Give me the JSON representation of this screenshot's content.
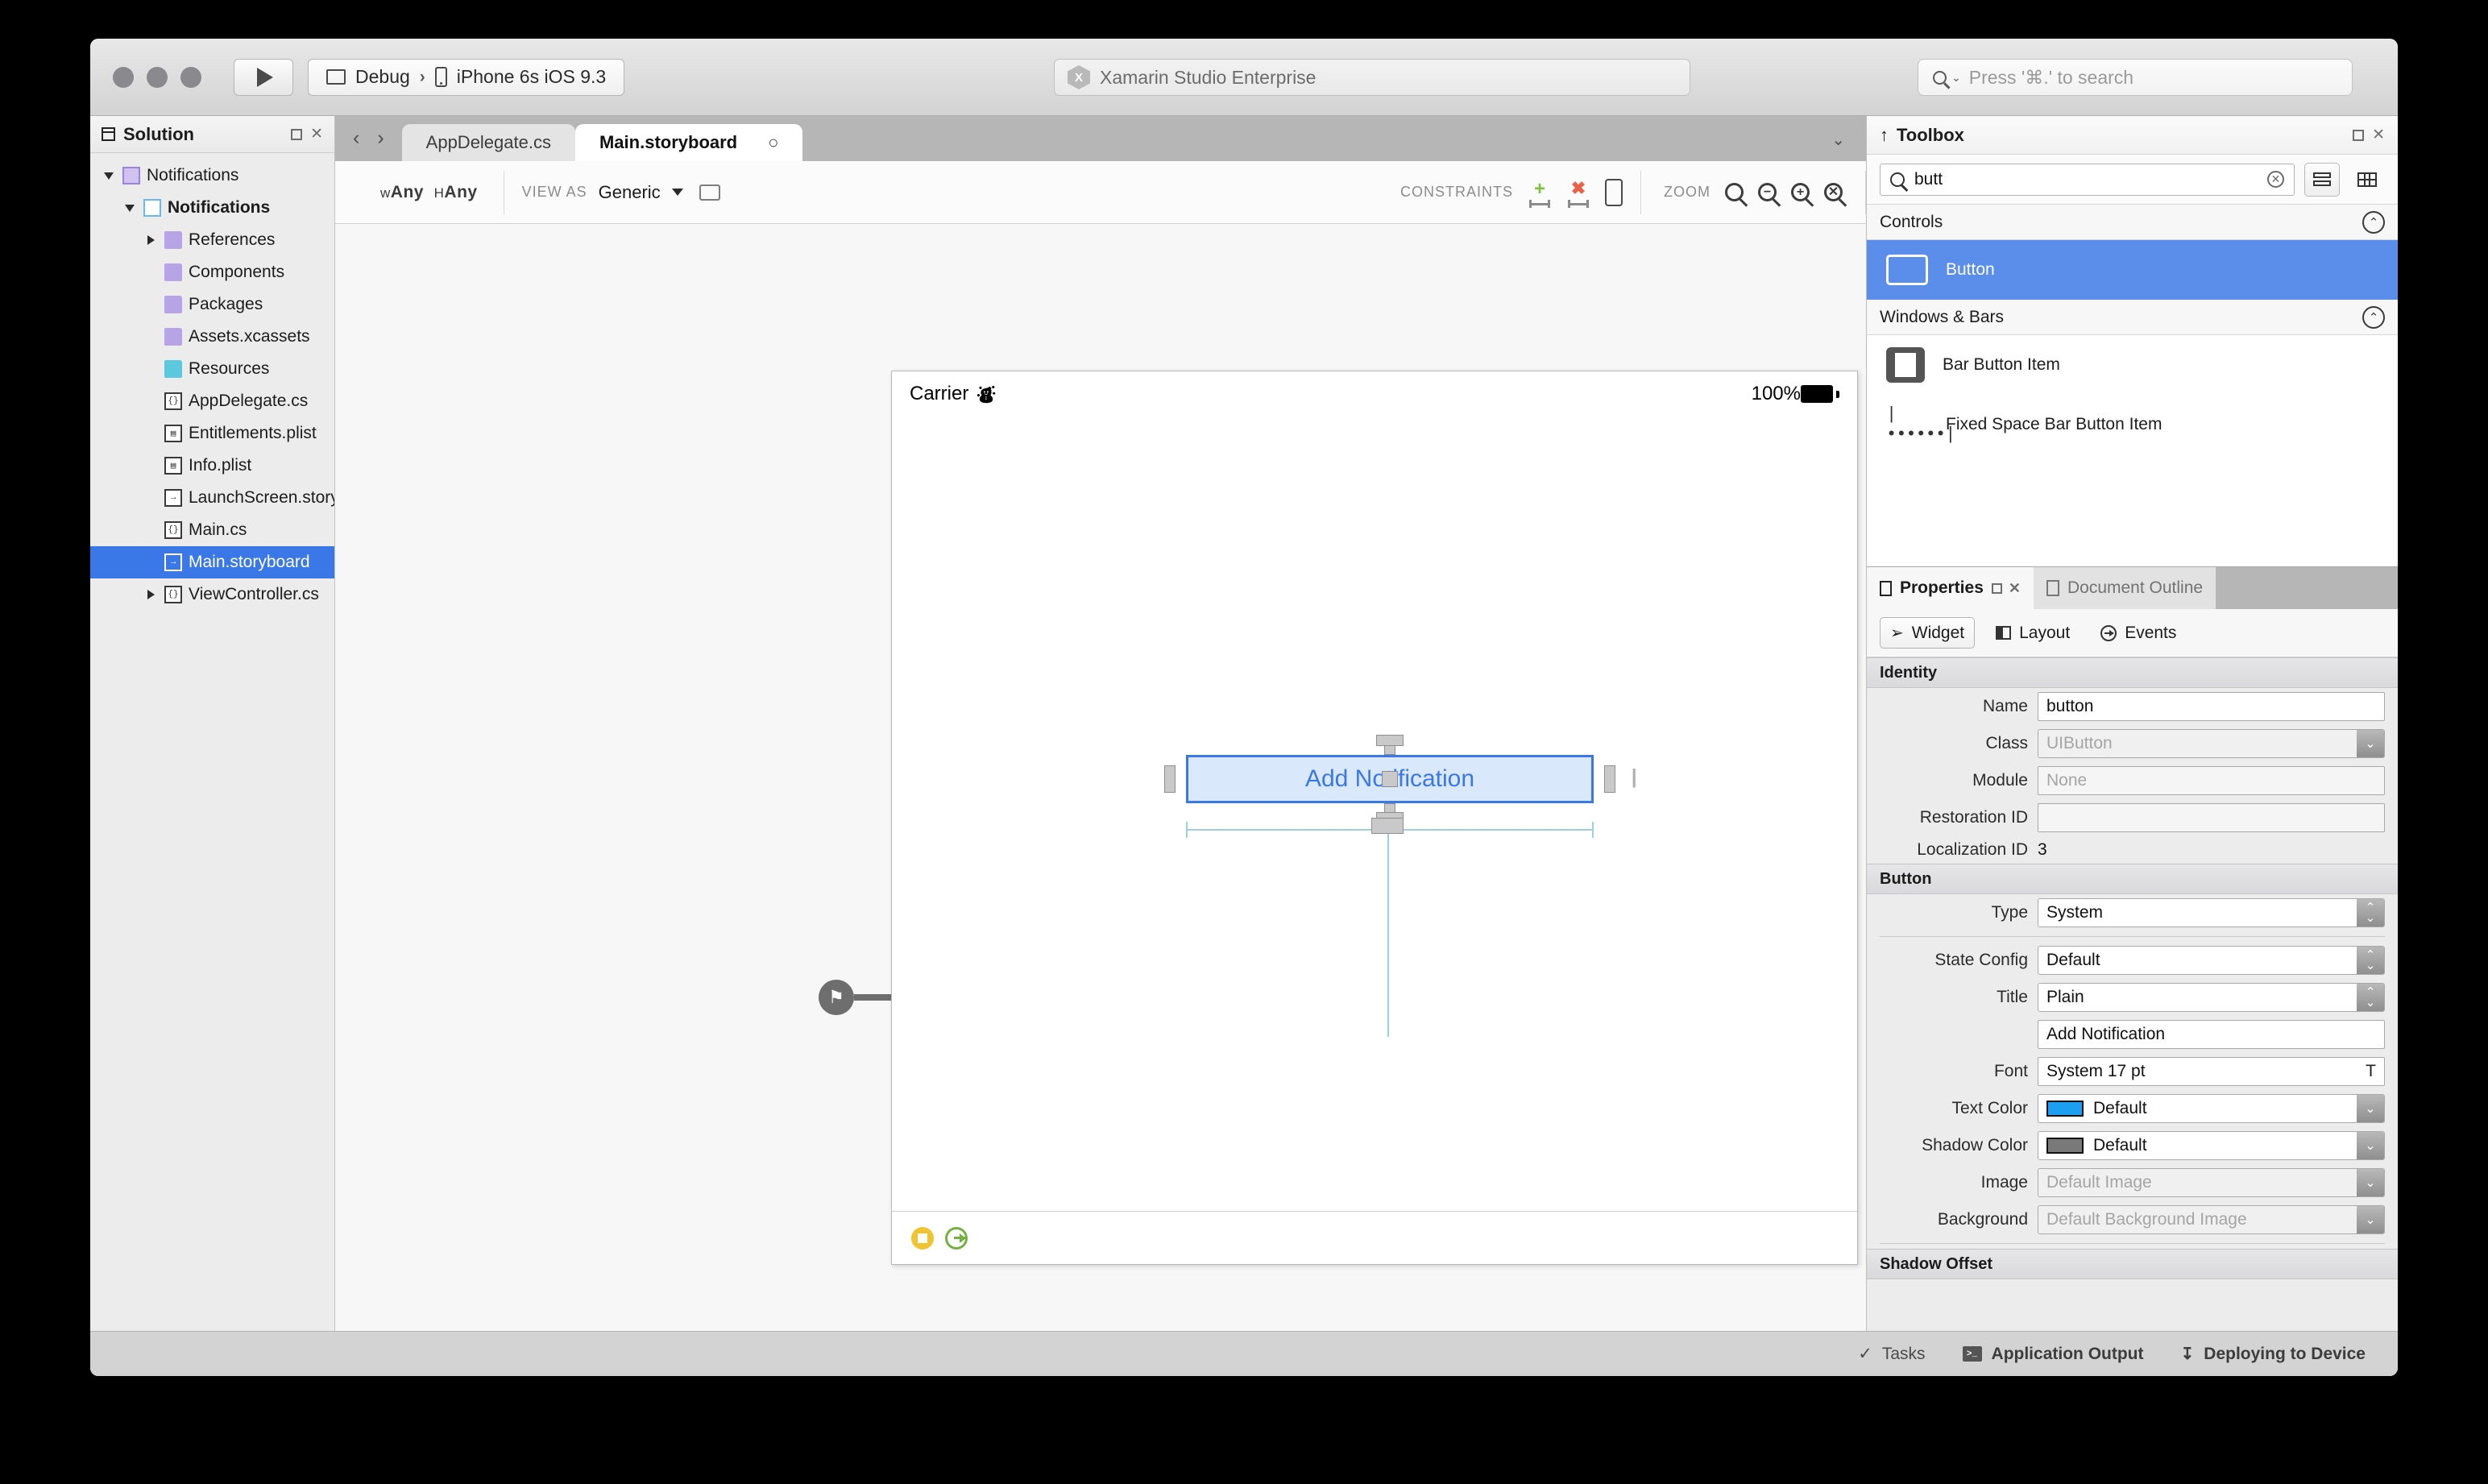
{
  "titlebar": {
    "run_label": "run-button",
    "configuration": "Debug",
    "device": "iPhone 6s iOS 9.3",
    "separator": "›",
    "status_badge": "X",
    "status_text": "Xamarin Studio Enterprise",
    "search_placeholder": "Press '⌘.' to search"
  },
  "solution": {
    "title": "Solution",
    "tree": [
      {
        "label": "Notifications",
        "icon": "solution-icon",
        "indent": 0,
        "twisty": "down",
        "selected": false,
        "bold": false
      },
      {
        "label": "Notifications",
        "icon": "project-icon",
        "indent": 1,
        "twisty": "down",
        "selected": false,
        "bold": true
      },
      {
        "label": "References",
        "icon": "folder-purple-icon",
        "indent": 2,
        "twisty": "right",
        "selected": false,
        "bold": false
      },
      {
        "label": "Components",
        "icon": "folder-purple-icon",
        "indent": 2,
        "twisty": "none",
        "selected": false,
        "bold": false
      },
      {
        "label": "Packages",
        "icon": "folder-purple-icon",
        "indent": 2,
        "twisty": "none",
        "selected": false,
        "bold": false
      },
      {
        "label": "Assets.xcassets",
        "icon": "folder-purple-icon",
        "indent": 2,
        "twisty": "none",
        "selected": false,
        "bold": false
      },
      {
        "label": "Resources",
        "icon": "folder-cyan-icon",
        "indent": 2,
        "twisty": "none",
        "selected": false,
        "bold": false
      },
      {
        "label": "AppDelegate.cs",
        "icon": "csharp-file-icon",
        "indent": 2,
        "twisty": "none",
        "selected": false,
        "bold": false
      },
      {
        "label": "Entitlements.plist",
        "icon": "plist-file-icon",
        "indent": 2,
        "twisty": "none",
        "selected": false,
        "bold": false
      },
      {
        "label": "Info.plist",
        "icon": "plist-file-icon",
        "indent": 2,
        "twisty": "none",
        "selected": false,
        "bold": false
      },
      {
        "label": "LaunchScreen.storyboard",
        "icon": "storyboard-file-icon",
        "indent": 2,
        "twisty": "none",
        "selected": false,
        "bold": false
      },
      {
        "label": "Main.cs",
        "icon": "csharp-file-icon",
        "indent": 2,
        "twisty": "none",
        "selected": false,
        "bold": false
      },
      {
        "label": "Main.storyboard",
        "icon": "storyboard-file-icon",
        "indent": 2,
        "twisty": "none",
        "selected": true,
        "bold": false
      },
      {
        "label": "ViewController.cs",
        "icon": "csharp-file-icon",
        "indent": 2,
        "twisty": "right",
        "selected": false,
        "bold": false
      }
    ]
  },
  "editor": {
    "tabs": [
      {
        "label": "AppDelegate.cs",
        "active": false,
        "modified": ""
      },
      {
        "label": "Main.storyboard",
        "active": true,
        "modified": "○"
      }
    ],
    "toolbar": {
      "size_class_w_prefix": "w",
      "size_class_w": "Any",
      "size_class_h_prefix": "H",
      "size_class_h": "Any",
      "view_as_caption": "VIEW AS",
      "view_as_value": "Generic",
      "constraints_caption": "CONSTRAINTS",
      "zoom_caption": "ZOOM"
    },
    "scene": {
      "carrier": "Carrier",
      "battery_percent": "100%",
      "button_title": "Add Notification"
    }
  },
  "toolbox": {
    "title": "Toolbox",
    "search_value": "butt",
    "groups": [
      {
        "name": "Controls",
        "items": [
          {
            "label": "Button",
            "icon": "button-icon",
            "selected": true
          }
        ]
      },
      {
        "name": "Windows & Bars",
        "items": [
          {
            "label": "Bar Button Item",
            "icon": "bar-button-item-icon",
            "selected": false
          },
          {
            "label": "Fixed Space Bar Button Item",
            "icon": "fixed-space-icon",
            "selected": false
          }
        ]
      }
    ]
  },
  "properties": {
    "tabs": [
      {
        "label": "Properties",
        "active": true
      },
      {
        "label": "Document Outline",
        "active": false
      }
    ],
    "modes": [
      {
        "label": "Widget",
        "active": true,
        "icon": "cursor-icon"
      },
      {
        "label": "Layout",
        "active": false,
        "icon": "layout-icon"
      },
      {
        "label": "Events",
        "active": false,
        "icon": "events-icon"
      }
    ],
    "sections": [
      {
        "title": "Identity",
        "rows": [
          {
            "label": "Name",
            "kind": "text",
            "value": "button",
            "placeholder": ""
          },
          {
            "label": "Class",
            "kind": "combo-chevron",
            "value": "",
            "placeholder": "UIButton"
          },
          {
            "label": "Module",
            "kind": "text",
            "value": "",
            "placeholder": "None"
          },
          {
            "label": "Restoration ID",
            "kind": "text",
            "value": "",
            "placeholder": ""
          },
          {
            "label": "Localization ID",
            "kind": "static",
            "value": "3",
            "placeholder": ""
          }
        ]
      },
      {
        "title": "Button",
        "rows": [
          {
            "label": "Type",
            "kind": "combo-stepper",
            "value": "System",
            "placeholder": ""
          },
          {
            "label": "State Config",
            "kind": "combo-stepper",
            "value": "Default",
            "placeholder": ""
          },
          {
            "label": "Title",
            "kind": "combo-stepper",
            "value": "Plain",
            "placeholder": ""
          },
          {
            "label": "",
            "kind": "text",
            "value": "Add Notification",
            "placeholder": ""
          },
          {
            "label": "Font",
            "kind": "font",
            "value": "System 17 pt",
            "placeholder": ""
          },
          {
            "label": "Text Color",
            "kind": "color-stepper",
            "value": "Default",
            "placeholder": "",
            "swatch": "#1c9ff0"
          },
          {
            "label": "Shadow Color",
            "kind": "color-stepper",
            "value": "Default",
            "placeholder": "",
            "swatch": "#797979"
          },
          {
            "label": "Image",
            "kind": "combo-chevron",
            "value": "",
            "placeholder": "Default Image"
          },
          {
            "label": "Background",
            "kind": "combo-chevron",
            "value": "",
            "placeholder": "Default Background Image"
          }
        ]
      },
      {
        "title": "Shadow Offset",
        "rows": []
      }
    ]
  },
  "footer": {
    "items": [
      {
        "label": "Tasks",
        "icon": "check-icon",
        "bold": false
      },
      {
        "label": "Application Output",
        "icon": "terminal-icon",
        "bold": true
      },
      {
        "label": "Deploying to Device",
        "icon": "download-icon",
        "bold": true
      }
    ]
  },
  "colors": {
    "accent": "#3b78e7",
    "toolbox_selection": "#5b8dea",
    "tree_selection": "#3b78e7",
    "ios_button_text": "#3b78e7",
    "text_color_swatch": "#1c9ff0"
  }
}
